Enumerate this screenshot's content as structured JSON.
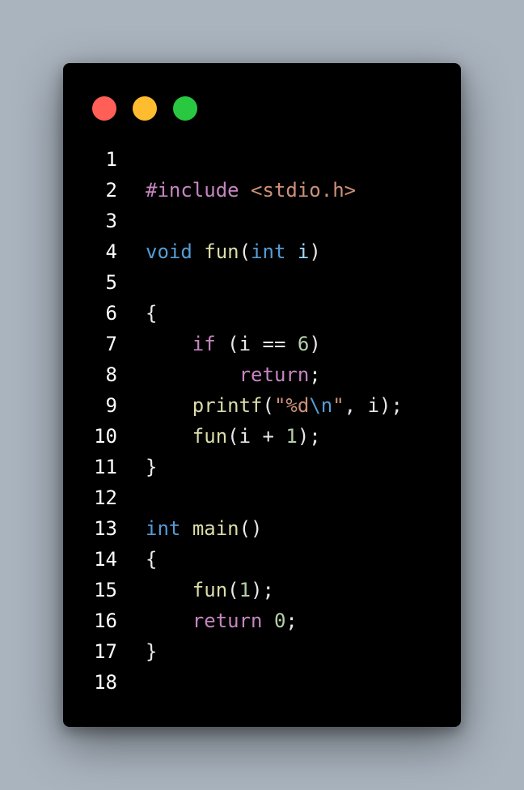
{
  "window": {
    "traffic_lights": [
      {
        "name": "close",
        "color": "#ff5f57"
      },
      {
        "name": "minimize",
        "color": "#febc2e"
      },
      {
        "name": "maximize",
        "color": "#28c840"
      }
    ]
  },
  "colors": {
    "preprocessor": "#c586c0",
    "include_path": "#ce9178",
    "type": "#569cd6",
    "function": "#dcdcaa",
    "param": "#9cdcfe",
    "keyword": "#c586c0",
    "number": "#b5cea8",
    "string": "#ce9178",
    "escape": "#569cd6",
    "plain": "#e8e8e8"
  },
  "code": {
    "lines": [
      {
        "num": "1",
        "tokens": []
      },
      {
        "num": "2",
        "tokens": [
          {
            "t": "#include",
            "c": "preprocessor"
          },
          {
            "t": " ",
            "c": "plain"
          },
          {
            "t": "<stdio.h>",
            "c": "include_path"
          }
        ]
      },
      {
        "num": "3",
        "tokens": []
      },
      {
        "num": "4",
        "tokens": [
          {
            "t": "void",
            "c": "type"
          },
          {
            "t": " ",
            "c": "plain"
          },
          {
            "t": "fun",
            "c": "function"
          },
          {
            "t": "(",
            "c": "plain"
          },
          {
            "t": "int",
            "c": "type"
          },
          {
            "t": " ",
            "c": "plain"
          },
          {
            "t": "i",
            "c": "param"
          },
          {
            "t": ")",
            "c": "plain"
          }
        ]
      },
      {
        "num": "5",
        "tokens": []
      },
      {
        "num": "6",
        "tokens": [
          {
            "t": "{",
            "c": "plain"
          }
        ]
      },
      {
        "num": "7",
        "tokens": [
          {
            "t": "    ",
            "c": "plain"
          },
          {
            "t": "if",
            "c": "keyword"
          },
          {
            "t": " (i == ",
            "c": "plain"
          },
          {
            "t": "6",
            "c": "number"
          },
          {
            "t": ")",
            "c": "plain"
          }
        ]
      },
      {
        "num": "8",
        "tokens": [
          {
            "t": "        ",
            "c": "plain"
          },
          {
            "t": "return",
            "c": "keyword"
          },
          {
            "t": ";",
            "c": "plain"
          }
        ]
      },
      {
        "num": "9",
        "tokens": [
          {
            "t": "    ",
            "c": "plain"
          },
          {
            "t": "printf",
            "c": "function"
          },
          {
            "t": "(",
            "c": "plain"
          },
          {
            "t": "\"%d",
            "c": "string"
          },
          {
            "t": "\\n",
            "c": "escape"
          },
          {
            "t": "\"",
            "c": "string"
          },
          {
            "t": ", i);",
            "c": "plain"
          }
        ]
      },
      {
        "num": "10",
        "tokens": [
          {
            "t": "    ",
            "c": "plain"
          },
          {
            "t": "fun",
            "c": "function"
          },
          {
            "t": "(i + ",
            "c": "plain"
          },
          {
            "t": "1",
            "c": "number"
          },
          {
            "t": ");",
            "c": "plain"
          }
        ]
      },
      {
        "num": "11",
        "tokens": [
          {
            "t": "}",
            "c": "plain"
          }
        ]
      },
      {
        "num": "12",
        "tokens": []
      },
      {
        "num": "13",
        "tokens": [
          {
            "t": "int",
            "c": "type"
          },
          {
            "t": " ",
            "c": "plain"
          },
          {
            "t": "main",
            "c": "function"
          },
          {
            "t": "()",
            "c": "plain"
          }
        ]
      },
      {
        "num": "14",
        "tokens": [
          {
            "t": "{",
            "c": "plain"
          }
        ]
      },
      {
        "num": "15",
        "tokens": [
          {
            "t": "    ",
            "c": "plain"
          },
          {
            "t": "fun",
            "c": "function"
          },
          {
            "t": "(",
            "c": "plain"
          },
          {
            "t": "1",
            "c": "number"
          },
          {
            "t": ");",
            "c": "plain"
          }
        ]
      },
      {
        "num": "16",
        "tokens": [
          {
            "t": "    ",
            "c": "plain"
          },
          {
            "t": "return",
            "c": "keyword"
          },
          {
            "t": " ",
            "c": "plain"
          },
          {
            "t": "0",
            "c": "number"
          },
          {
            "t": ";",
            "c": "plain"
          }
        ]
      },
      {
        "num": "17",
        "tokens": [
          {
            "t": "}",
            "c": "plain"
          }
        ]
      },
      {
        "num": "18",
        "tokens": []
      }
    ]
  }
}
